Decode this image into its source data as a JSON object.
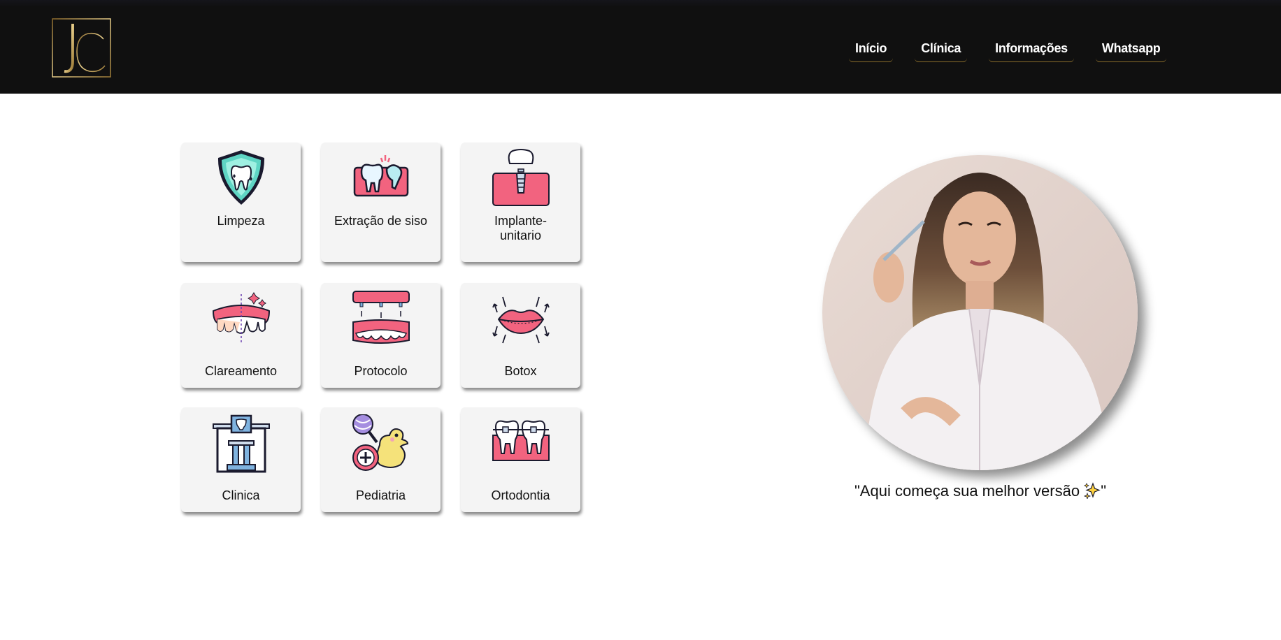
{
  "header": {
    "logo_text": "JC",
    "nav": [
      {
        "label": "Início"
      },
      {
        "label": "Clínica"
      },
      {
        "label": "Informações"
      },
      {
        "label": "Whatsapp"
      }
    ]
  },
  "services": [
    {
      "label": "Limpeza",
      "icon": "shield-tooth-icon"
    },
    {
      "label": "Extração de siso",
      "icon": "wisdom-tooth-icon"
    },
    {
      "label": "Implante-\nunitario",
      "icon": "dental-implant-icon"
    },
    {
      "label": "Clareamento",
      "icon": "whitening-icon"
    },
    {
      "label": "Protocolo",
      "icon": "denture-protocol-icon"
    },
    {
      "label": "Botox",
      "icon": "lips-botox-icon"
    },
    {
      "label": "Clinica",
      "icon": "clinic-building-icon"
    },
    {
      "label": "Pediatria",
      "icon": "rattle-duck-icon"
    },
    {
      "label": "Ortodontia",
      "icon": "braces-icon"
    }
  ],
  "hero": {
    "quote_open": "\"Aqui começa sua melhor versão ",
    "quote_close": "\"",
    "quote_emoji": "sparkles-icon"
  },
  "colors": {
    "header_bg": "#101010",
    "gold": "#c9a24a",
    "card_bg": "#f4f4f4",
    "accent_pink": "#f2637f",
    "accent_teal": "#5fd5c4"
  }
}
